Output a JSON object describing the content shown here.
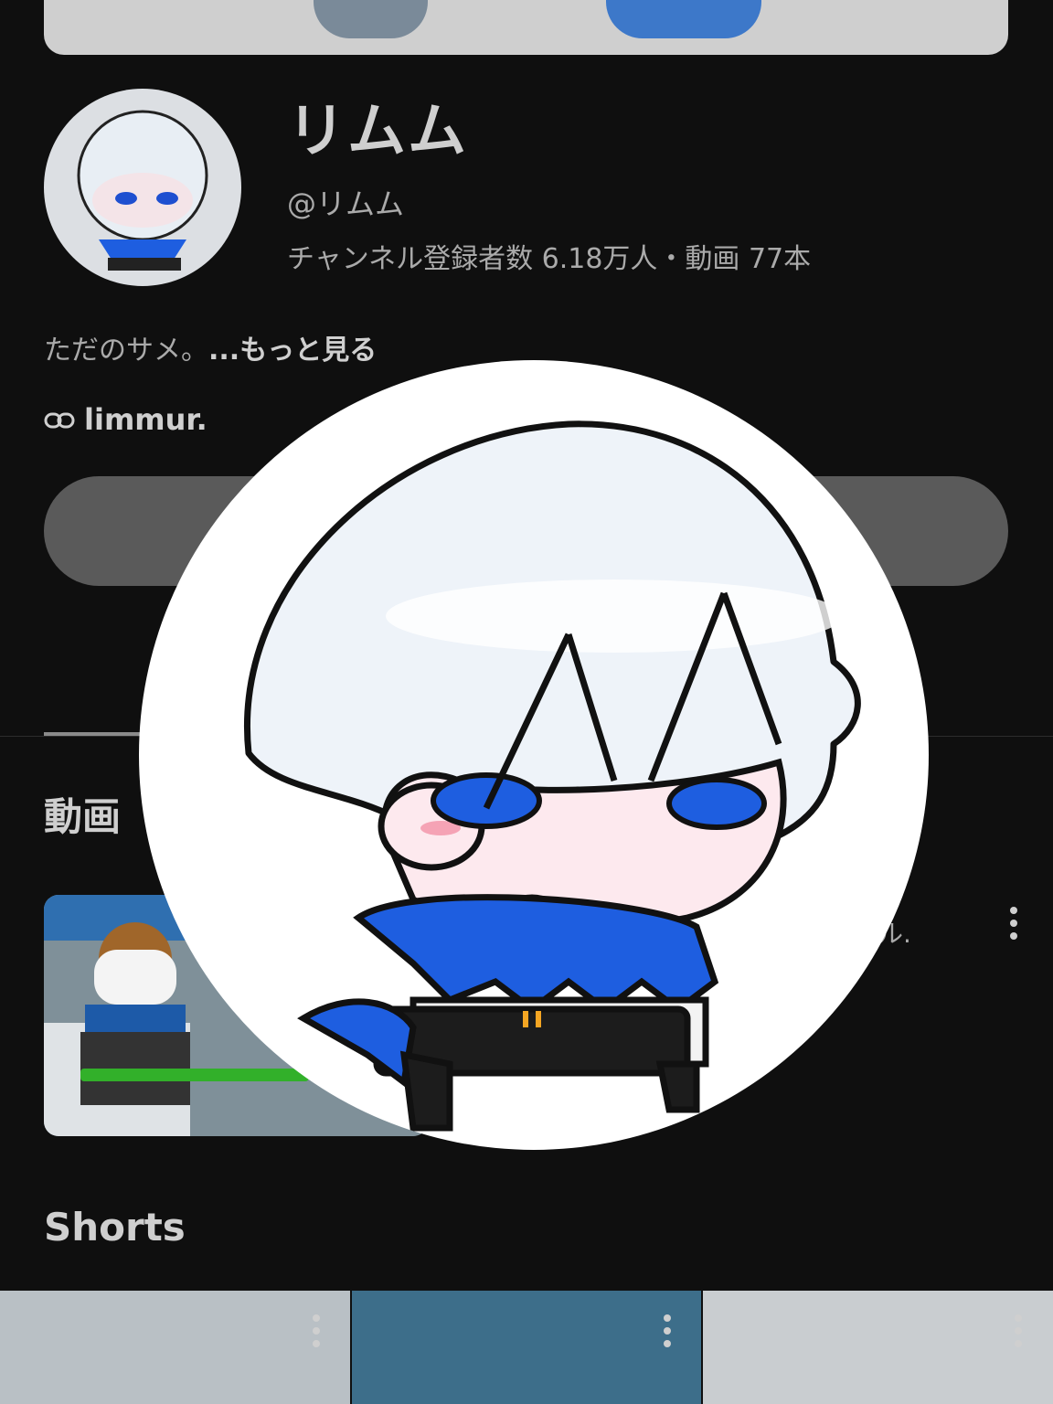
{
  "channel": {
    "name": "リムム",
    "handle": "@リムム",
    "stats": "チャンネル登録者数 6.18万人・動画 77本",
    "description": "ただのサメ。",
    "more_label": "...もっと見る",
    "link": "limmur."
  },
  "sections": {
    "videos_title": "動画",
    "shorts_title": "Shorts"
  },
  "video": {
    "title_fragment": "ル."
  },
  "colors": {
    "background": "#0f0f0f",
    "overlay_avatar_bg": "#ffffff",
    "accent_blue": "#1e66e0"
  },
  "icons": {
    "link": "link-icon",
    "more": "more-vert-icon"
  }
}
